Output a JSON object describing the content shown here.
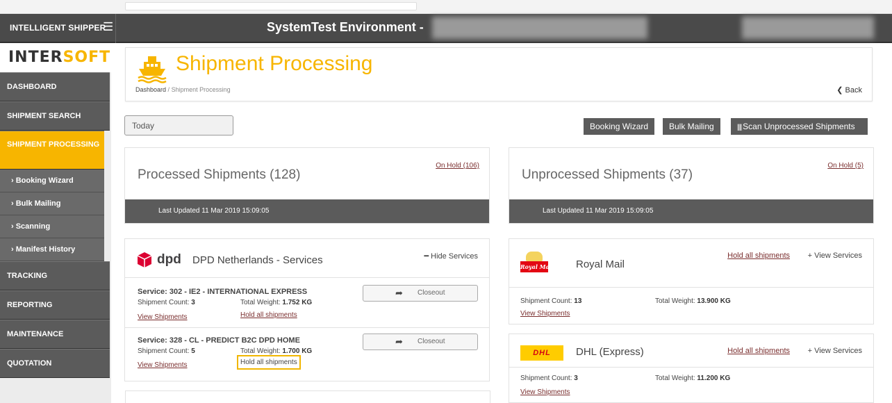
{
  "header": {
    "brand": "INTELLIGENT SHIPPER",
    "menu_icon": "hamburger-icon",
    "environment": "SystemTest Environment -"
  },
  "sidebar": {
    "logo_part1": "INTER",
    "logo_part2": "SOFT",
    "items": [
      {
        "label": "DASHBOARD"
      },
      {
        "label": "SHIPMENT SEARCH"
      },
      {
        "label": "SHIPMENT PROCESSING",
        "active": true
      },
      {
        "label": "TRACKING"
      },
      {
        "label": "REPORTING"
      },
      {
        "label": "MAINTENANCE"
      },
      {
        "label": "QUOTATION"
      }
    ],
    "subitems": [
      {
        "label": "› Booking Wizard"
      },
      {
        "label": "› Bulk Mailing"
      },
      {
        "label": "› Scanning"
      },
      {
        "label": "› Manifest History"
      }
    ]
  },
  "page": {
    "title": "Shipment Processing",
    "title_icon": "ship-icon",
    "breadcrumb_home": "Dashboard",
    "breadcrumb_sep": "/",
    "breadcrumb_current": "Shipment Processing",
    "back": "❮ Back",
    "accent": "#f7b500"
  },
  "toolbar": {
    "date_value": "Today",
    "booking_wizard": "Booking Wizard",
    "bulk_mailing": "Bulk Mailing",
    "scan_unprocessed": "Scan Unprocessed Shipments"
  },
  "processed": {
    "title": "Processed Shipments (128)",
    "on_hold": "On Hold (106)",
    "last_updated": "Last Updated 11 Mar 2019 15:09:05"
  },
  "unprocessed": {
    "title": "Unprocessed Shipments (37)",
    "on_hold": "On Hold (5)",
    "last_updated": "Last Updated 11 Mar 2019 15:09:05"
  },
  "dpd": {
    "logo_text": "dpd",
    "name": "DPD Netherlands - Services",
    "hide_services": "━ Hide Services",
    "services": [
      {
        "name": "Service: 302 - IE2 - INTERNATIONAL EXPRESS",
        "count_label": "Shipment Count:",
        "count": "3",
        "weight_label": "Total Weight:",
        "weight": "1.752 KG",
        "view": "View Shipments",
        "hold": "Hold all shipments",
        "closeout": "Closeout"
      },
      {
        "name": "Service: 328 - CL - PREDICT B2C DPD HOME",
        "count_label": "Shipment Count:",
        "count": "5",
        "weight_label": "Total Weight:",
        "weight": "1.700 KG",
        "view": "View Shipments",
        "hold": "Hold all shipments",
        "closeout": "Closeout"
      }
    ]
  },
  "royalmail": {
    "logo_text": "Royal Mail",
    "name": "Royal Mail",
    "hold": "Hold all shipments",
    "view_services": "+ View Services",
    "count_label": "Shipment Count:",
    "count": "13",
    "weight_label": "Total Weight:",
    "weight": "13.900 KG",
    "view": "View Shipments"
  },
  "dhl": {
    "logo_text": "DHL",
    "name": "DHL (Express)",
    "hold": "Hold all shipments",
    "view_services": "+ View Services",
    "count_label": "Shipment Count:",
    "count": "3",
    "weight_label": "Total Weight:",
    "weight": "11.200 KG",
    "view": "View Shipments"
  }
}
